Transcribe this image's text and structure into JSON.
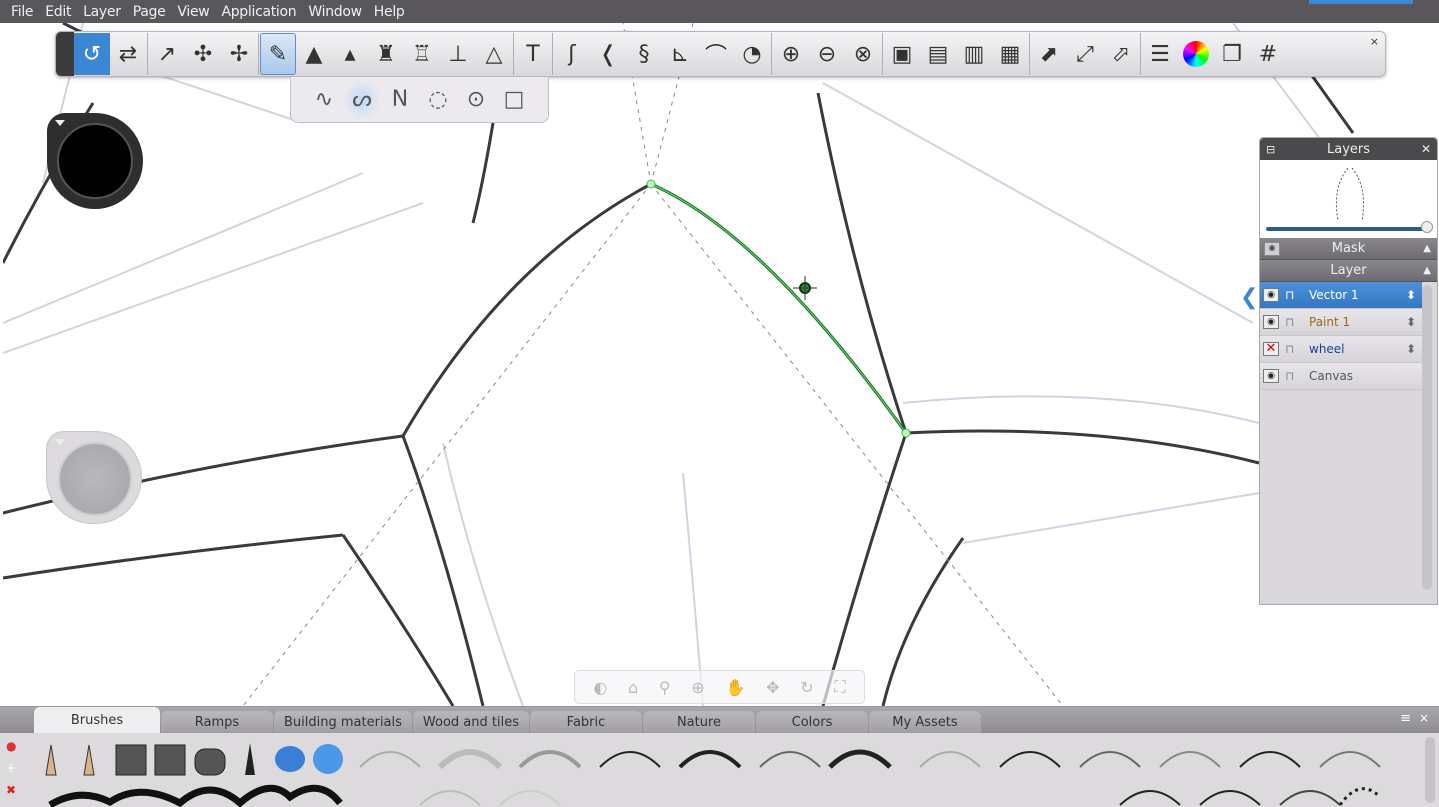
{
  "menu": [
    "File",
    "Edit",
    "Layer",
    "Page",
    "View",
    "Application",
    "Window",
    "Help"
  ],
  "toolbar": {
    "groups": [
      [
        {
          "icon": "lasso-icon",
          "glyph": "↺",
          "state": "active"
        },
        {
          "icon": "swap-icon",
          "glyph": "⇄"
        }
      ],
      [
        {
          "icon": "select-curve-icon",
          "glyph": "↗"
        },
        {
          "icon": "edit-nodes-icon",
          "glyph": "✣"
        },
        {
          "icon": "transform-nodes-icon",
          "glyph": "✢"
        }
      ],
      [
        {
          "icon": "pencil-icon",
          "glyph": "✎",
          "state": "selected"
        },
        {
          "icon": "ballpoint-pen-icon",
          "glyph": "▲"
        },
        {
          "icon": "paintbrush-icon",
          "glyph": "▴"
        },
        {
          "icon": "marker-icon",
          "glyph": "♜"
        },
        {
          "icon": "chisel-marker-icon",
          "glyph": "♖"
        },
        {
          "icon": "airbrush-icon",
          "glyph": "⊥"
        },
        {
          "icon": "fineliner-icon",
          "glyph": "△"
        }
      ],
      [
        {
          "icon": "text-icon",
          "glyph": "T"
        }
      ],
      [
        {
          "icon": "french-curve-icon",
          "glyph": "ʃ"
        },
        {
          "icon": "curve-ruler-icon",
          "glyph": "❬"
        },
        {
          "icon": "s-curve-icon",
          "glyph": "§"
        },
        {
          "icon": "perspective-icon",
          "glyph": "⊾"
        },
        {
          "icon": "arc-icon",
          "glyph": "⌒"
        },
        {
          "icon": "ellipse-guide-icon",
          "glyph": "◔"
        }
      ],
      [
        {
          "icon": "symmetry-x-icon",
          "glyph": "⊕"
        },
        {
          "icon": "symmetry-y-icon",
          "glyph": "⊖"
        },
        {
          "icon": "radial-symmetry-icon",
          "glyph": "⊗"
        }
      ],
      [
        {
          "icon": "layer-add-icon",
          "glyph": "▣"
        },
        {
          "icon": "layer-duplicate-icon",
          "glyph": "▤"
        },
        {
          "icon": "layer-merge-icon",
          "glyph": "▥"
        },
        {
          "icon": "layer-image-icon",
          "glyph": "▦"
        }
      ],
      [
        {
          "icon": "distort-icon",
          "glyph": "⬈"
        },
        {
          "icon": "scale-icon",
          "glyph": "⤢"
        },
        {
          "icon": "warp-icon",
          "glyph": "⬀"
        }
      ],
      [
        {
          "icon": "brush-properties-icon",
          "glyph": "☰"
        },
        {
          "icon": "color-wheel-icon",
          "glyph": "◯"
        },
        {
          "icon": "copy-icon",
          "glyph": "❐"
        },
        {
          "icon": "grid-icon",
          "glyph": "#"
        }
      ]
    ],
    "close": "×"
  },
  "subtoolbar": [
    {
      "icon": "freehand-stroke-icon",
      "glyph": "∿"
    },
    {
      "icon": "bezier-curve-icon",
      "glyph": "ᔕ",
      "state": "selected"
    },
    {
      "icon": "polyline-icon",
      "glyph": "Ν"
    },
    {
      "icon": "circle-3point-icon",
      "glyph": "◌"
    },
    {
      "icon": "circle-center-icon",
      "glyph": "⊙"
    },
    {
      "icon": "rectangle-icon",
      "glyph": "□"
    }
  ],
  "colors": {
    "accent": "#3d86d4",
    "current_color": "#000000",
    "menubar": "#59575b",
    "vector_curve": "#2fa83a"
  },
  "layers": {
    "title": "Layers",
    "opacity_percent": 100,
    "mask_label": "Mask",
    "layer_label": "Layer",
    "items": [
      {
        "name": "Vector 1",
        "visible": true,
        "selected": true,
        "color": "#ffffff"
      },
      {
        "name": "Paint 1",
        "visible": true,
        "color": "#9a6a18"
      },
      {
        "name": "wheel",
        "visible": false,
        "color": "#1a3f9a"
      },
      {
        "name": "Canvas",
        "visible": true,
        "color": "#555555"
      }
    ]
  },
  "navigation": [
    "tumble-icon",
    "home-icon",
    "zoom-icon",
    "zoom-in-icon",
    "pan-icon",
    "move-icon",
    "rotate-icon",
    "fit-icon"
  ],
  "library": {
    "tabs": [
      "Brushes",
      "Ramps",
      "Building materials",
      "Wood and tiles",
      "Fabric",
      "Nature",
      "Colors",
      "My Assets"
    ],
    "active_tab": "Brushes",
    "menu_icon": "≡",
    "close_icon": "×"
  }
}
